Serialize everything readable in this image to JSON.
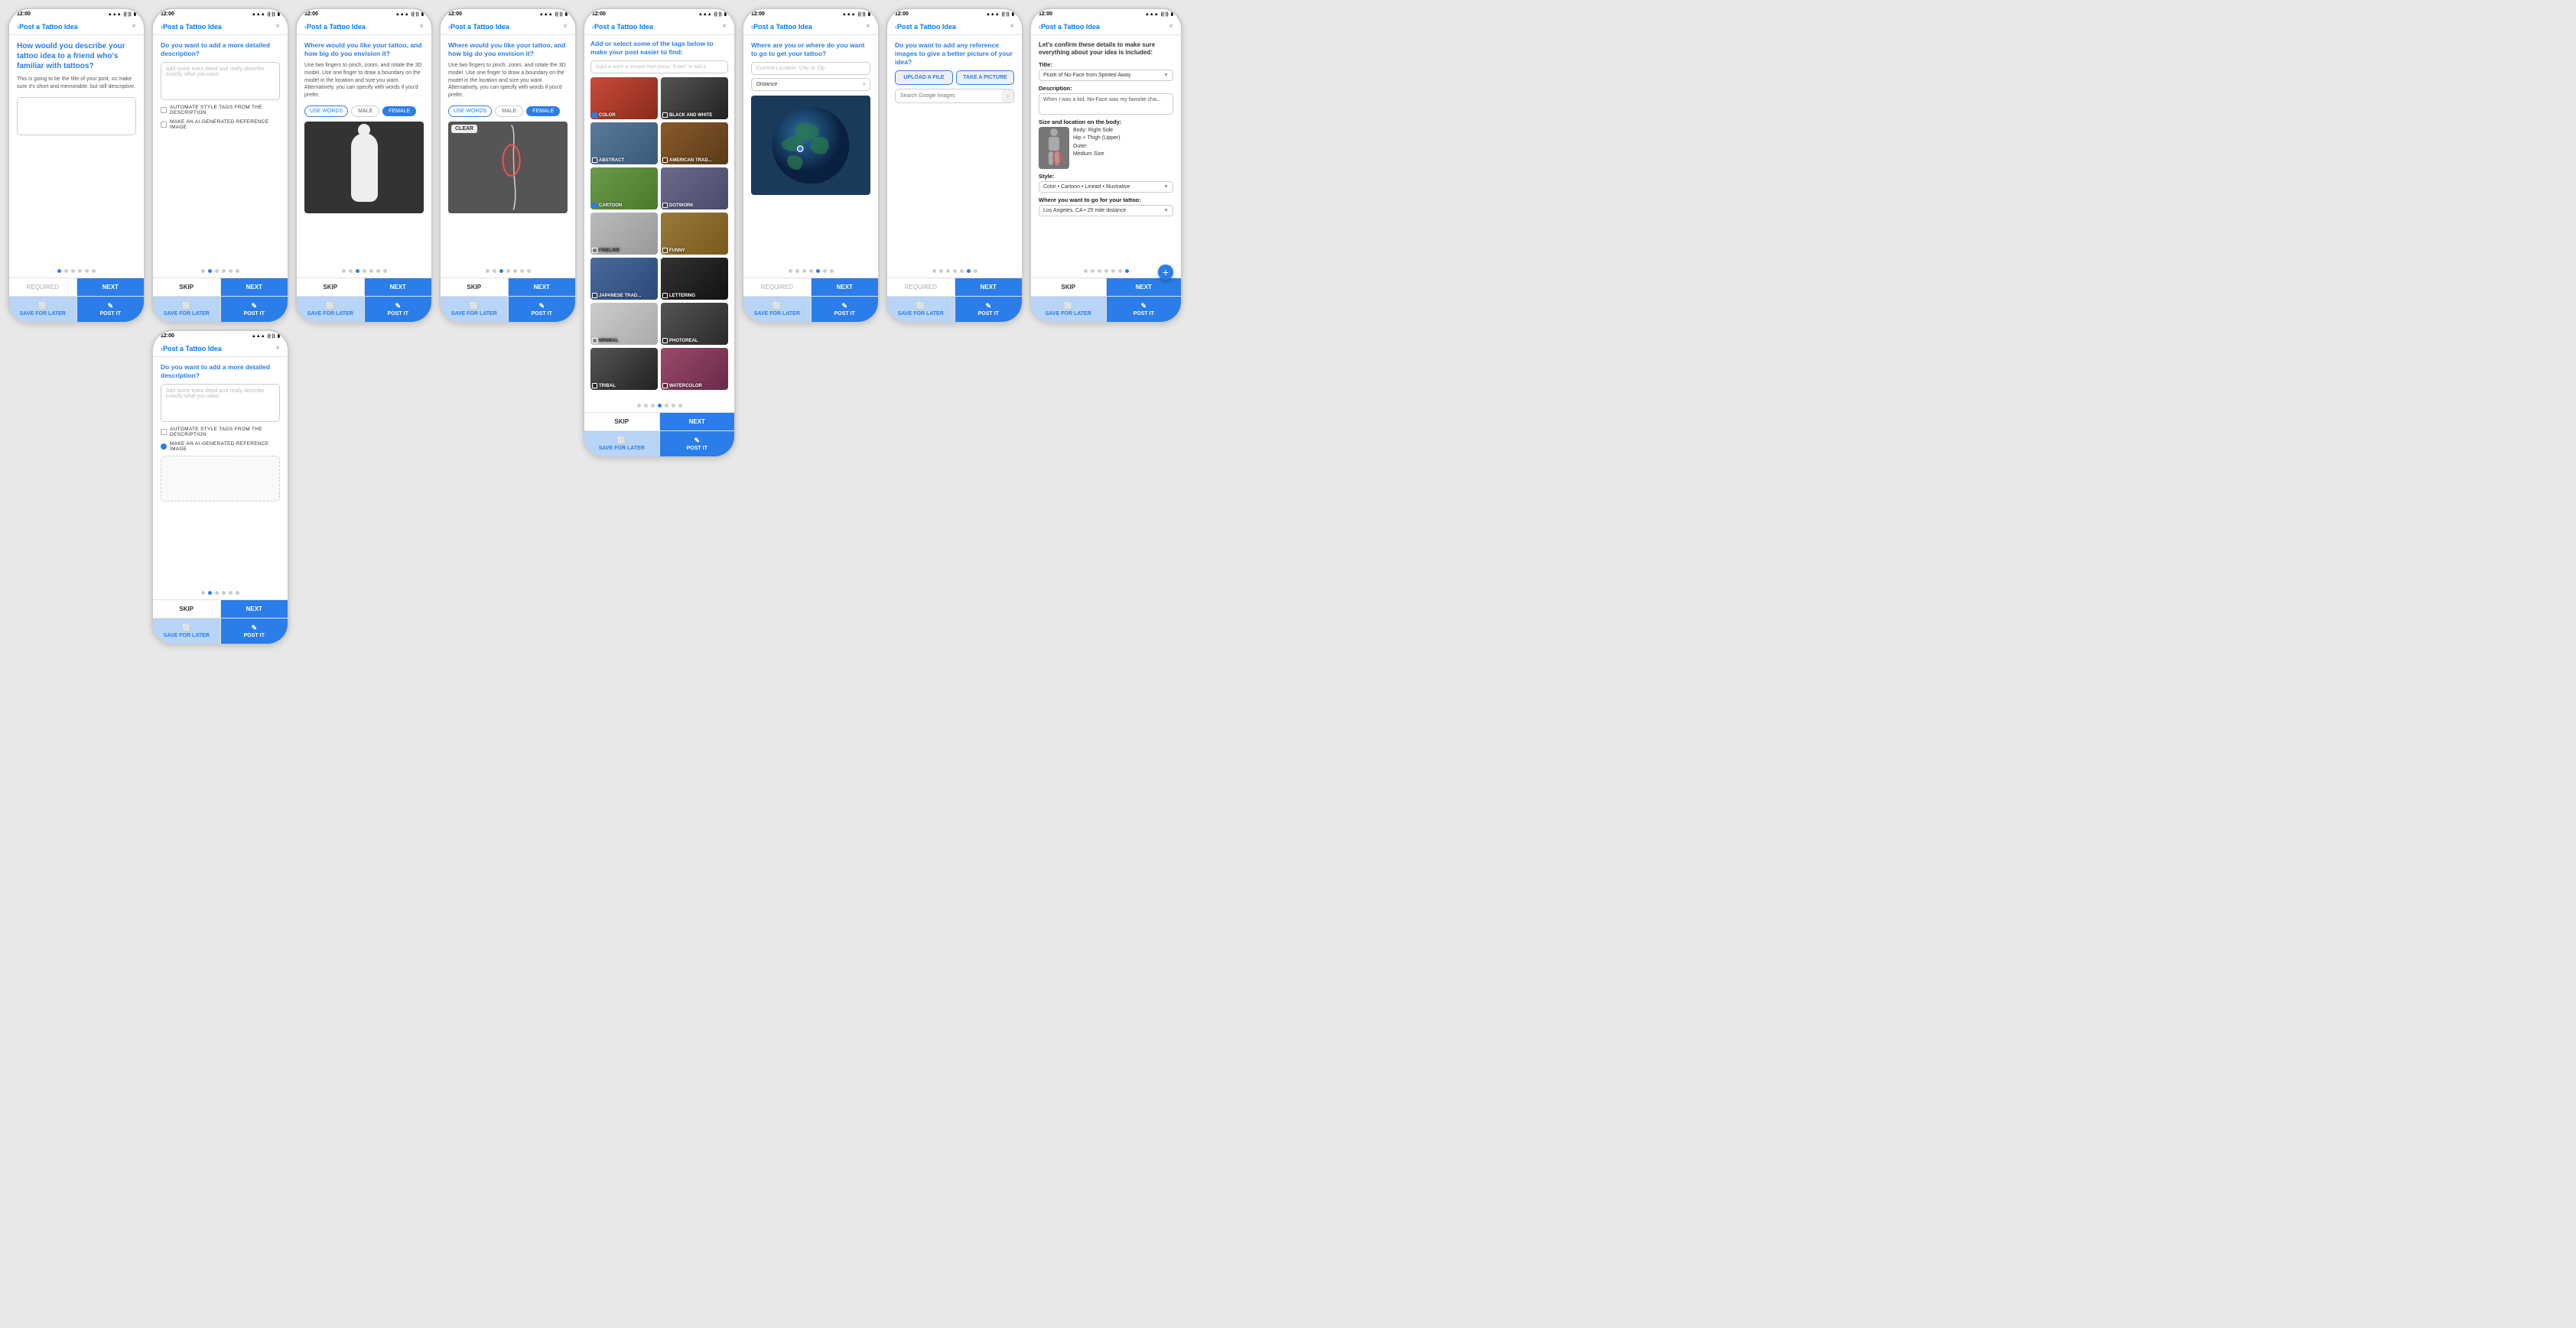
{
  "screens": [
    {
      "id": "screen1",
      "status_time": "12:00",
      "nav_title": "Post a Tattoo Idea",
      "main_question": "How would you describe your tattoo idea to a friend who's familiar with tattoos?",
      "body_text": "This is going to be the title of your post, so make sure it's short and memorable, but still descriptive.",
      "dots_total": 6,
      "dots_active": 0,
      "btn_skip": "REQUIRED",
      "btn_next": "NEXT",
      "save_label": "SAVE FOR LATER",
      "post_label": "POST IT"
    },
    {
      "id": "screen2",
      "status_time": "12:00",
      "nav_title": "Post a Tattoo Idea",
      "subtitle": "Do you want to add a more detailed description?",
      "placeholder": "Add some extra detail and really describe exactly what you want.",
      "checkbox1_label": "AUTOMATE STYLE TAGS FROM THE DESCRIPTION",
      "checkbox2_label": "MAKE AN AI-GENERATED REFERENCE IMAGE",
      "dots_total": 6,
      "dots_active": 1,
      "btn_skip": "SKIP",
      "btn_next": "NEXT",
      "save_label": "SAVE FOR LATER",
      "post_label": "POST IT"
    },
    {
      "id": "screen2b",
      "status_time": "12:00",
      "nav_title": "Post a Tattoo Idea",
      "subtitle": "Do you want to add a more detailed description?",
      "placeholder": "Add some extra detail and really describe exactly what you want.",
      "checkbox1_label": "AUTOMATE STYLE TAGS FROM THE DESCRIPTION",
      "checkbox2_label": "MAKE AN AI-GENERATED REFERENCE IMAGE",
      "dots_total": 6,
      "dots_active": 1,
      "btn_skip": "SKIP",
      "btn_next": "NEXT",
      "save_label": "SAVE FOR LATER",
      "post_label": "POST IT",
      "radio2_checked": true
    },
    {
      "id": "screen3",
      "status_time": "12:00",
      "nav_title": "Post a Tattoo Idea",
      "question": "Where would you like your tattoo, and how big do you envision it?",
      "description": "Use two fingers to pinch, zoom, and rotate the 3D model. Use one finger to draw a boundary on the model in the location and size you want. Alternatively, you can specify with words if you'd prefer.",
      "tab_use_words": "USE WORDS",
      "tab_male": "MALE",
      "tab_female": "FEMALE",
      "dots_total": 7,
      "dots_active": 2,
      "btn_skip": "SKIP",
      "btn_next": "NEXT",
      "save_label": "SAVE FOR LATER",
      "post_label": "POST IT"
    },
    {
      "id": "screen3b",
      "status_time": "12:00",
      "nav_title": "Post a Tattoo Idea",
      "question": "Where would you like your tattoo, and how big do you envision it?",
      "description": "Use two fingers to pinch, zoom, and rotate the 3D model. Use one finger to draw a boundary on the model in the location and size you want. Alternatively, you can specify with words if you'd prefer.",
      "tab_use_words": "USE WORDS",
      "tab_male": "MALE",
      "tab_female": "FEMALE",
      "clear_btn": "CLEAR",
      "dots_total": 7,
      "dots_active": 2,
      "btn_skip": "SKIP",
      "btn_next": "NEXT",
      "save_label": "SAVE FOR LATER",
      "post_label": "POST IT"
    },
    {
      "id": "screen4",
      "status_time": "12:00",
      "nav_title": "Post a Tattoo Idea",
      "question": "Add or select some of the tags below to make your post easier to find:",
      "tag_search_placeholder": "Input a word or phrase then press \"Enter\" to add it",
      "tags": [
        {
          "label": "COLOR",
          "checked": true,
          "bg": "#c84b3a"
        },
        {
          "label": "BLACK AND WHITE",
          "checked": false,
          "bg": "#333"
        },
        {
          "label": "ABSTRACT",
          "checked": false,
          "bg": "#5a7a9a"
        },
        {
          "label": "AMERICAN TRAD...",
          "checked": false,
          "bg": "#8a4a2a"
        },
        {
          "label": "CARTOON",
          "checked": true,
          "bg": "#6a8a4a"
        },
        {
          "label": "DOTWORK",
          "checked": false,
          "bg": "#4a4a6a"
        },
        {
          "label": "FINELINE",
          "checked": false,
          "bg": "#aaa"
        },
        {
          "label": "FUNNY",
          "checked": false,
          "bg": "#9a7a3a"
        },
        {
          "label": "JAPANESE TRAD...",
          "checked": false,
          "bg": "#4a6a8a"
        },
        {
          "label": "LETTERING",
          "checked": false,
          "bg": "#222"
        },
        {
          "label": "MINIMAL",
          "checked": false,
          "bg": "#bbb"
        },
        {
          "label": "PHOTOREAL",
          "checked": false,
          "bg": "#333"
        },
        {
          "label": "TRIBAL",
          "checked": false,
          "bg": "#444"
        },
        {
          "label": "WATERCOLOR",
          "checked": false,
          "bg": "#8a4a6a"
        }
      ],
      "dots_total": 7,
      "dots_active": 3,
      "btn_skip": "SKIP",
      "btn_next": "NEXT",
      "save_label": "SAVE FOR LATER",
      "post_label": "POST IT"
    },
    {
      "id": "screen5",
      "status_time": "12:00",
      "nav_title": "Post a Tattoo Idea",
      "question": "Where are you or where do you want to go to get your tattoo?",
      "location_placeholder": "Current Location, City, or Zip",
      "distance_label": "Distance",
      "dots_total": 7,
      "dots_active": 4,
      "btn_skip": "REQUIRED",
      "btn_next": "NEXT",
      "save_label": "SAVE FOR LATER",
      "post_label": "POST IT"
    },
    {
      "id": "screen6",
      "status_time": "12:00",
      "nav_title": "Post a Tattoo Idea",
      "question": "Do you want to add any reference images to give a better picture of your idea?",
      "upload_btn": "UPLOAD A FILE",
      "take_btn": "TAKE A PICTURE",
      "search_placeholder": "Search Google Images",
      "dots_total": 7,
      "dots_active": 5,
      "btn_skip": "REQUIRED",
      "btn_next": "NEXT",
      "save_label": "SAVE FOR LATER",
      "post_label": "POST IT"
    },
    {
      "id": "screen7",
      "status_time": "12:00",
      "nav_title": "Post a Tattoo Idea",
      "intro": "Let's confirm these details to make sure everything about your idea is included:",
      "title_label": "Title:",
      "title_value": "Plush of No-Face from Spirited Away",
      "desc_label": "Description:",
      "desc_value": "When I was a kid, No-Face was my favorite cha...",
      "size_location_label": "Size and location on the body:",
      "body_details": "Body: Right Side\nHip + Thigh (Upper)\nOuter\nMedium Size",
      "style_label": "Style:",
      "style_value": "Color • Cartoon • Lineart • Illustrative",
      "location_label": "Where you want to go for your tattoo:",
      "location_value": "Los Angeles, CA • 25 mile distance",
      "dots_total": 7,
      "dots_active": 6,
      "btn_skip": "SKIP",
      "btn_next": "NEXT",
      "save_label": "SAVE FOR LATER",
      "post_label": "POST IT"
    }
  ],
  "icons": {
    "back_arrow": "‹",
    "close": "×",
    "save": "⬜",
    "post": "✎",
    "chevron_down": "›",
    "plus": "+"
  }
}
